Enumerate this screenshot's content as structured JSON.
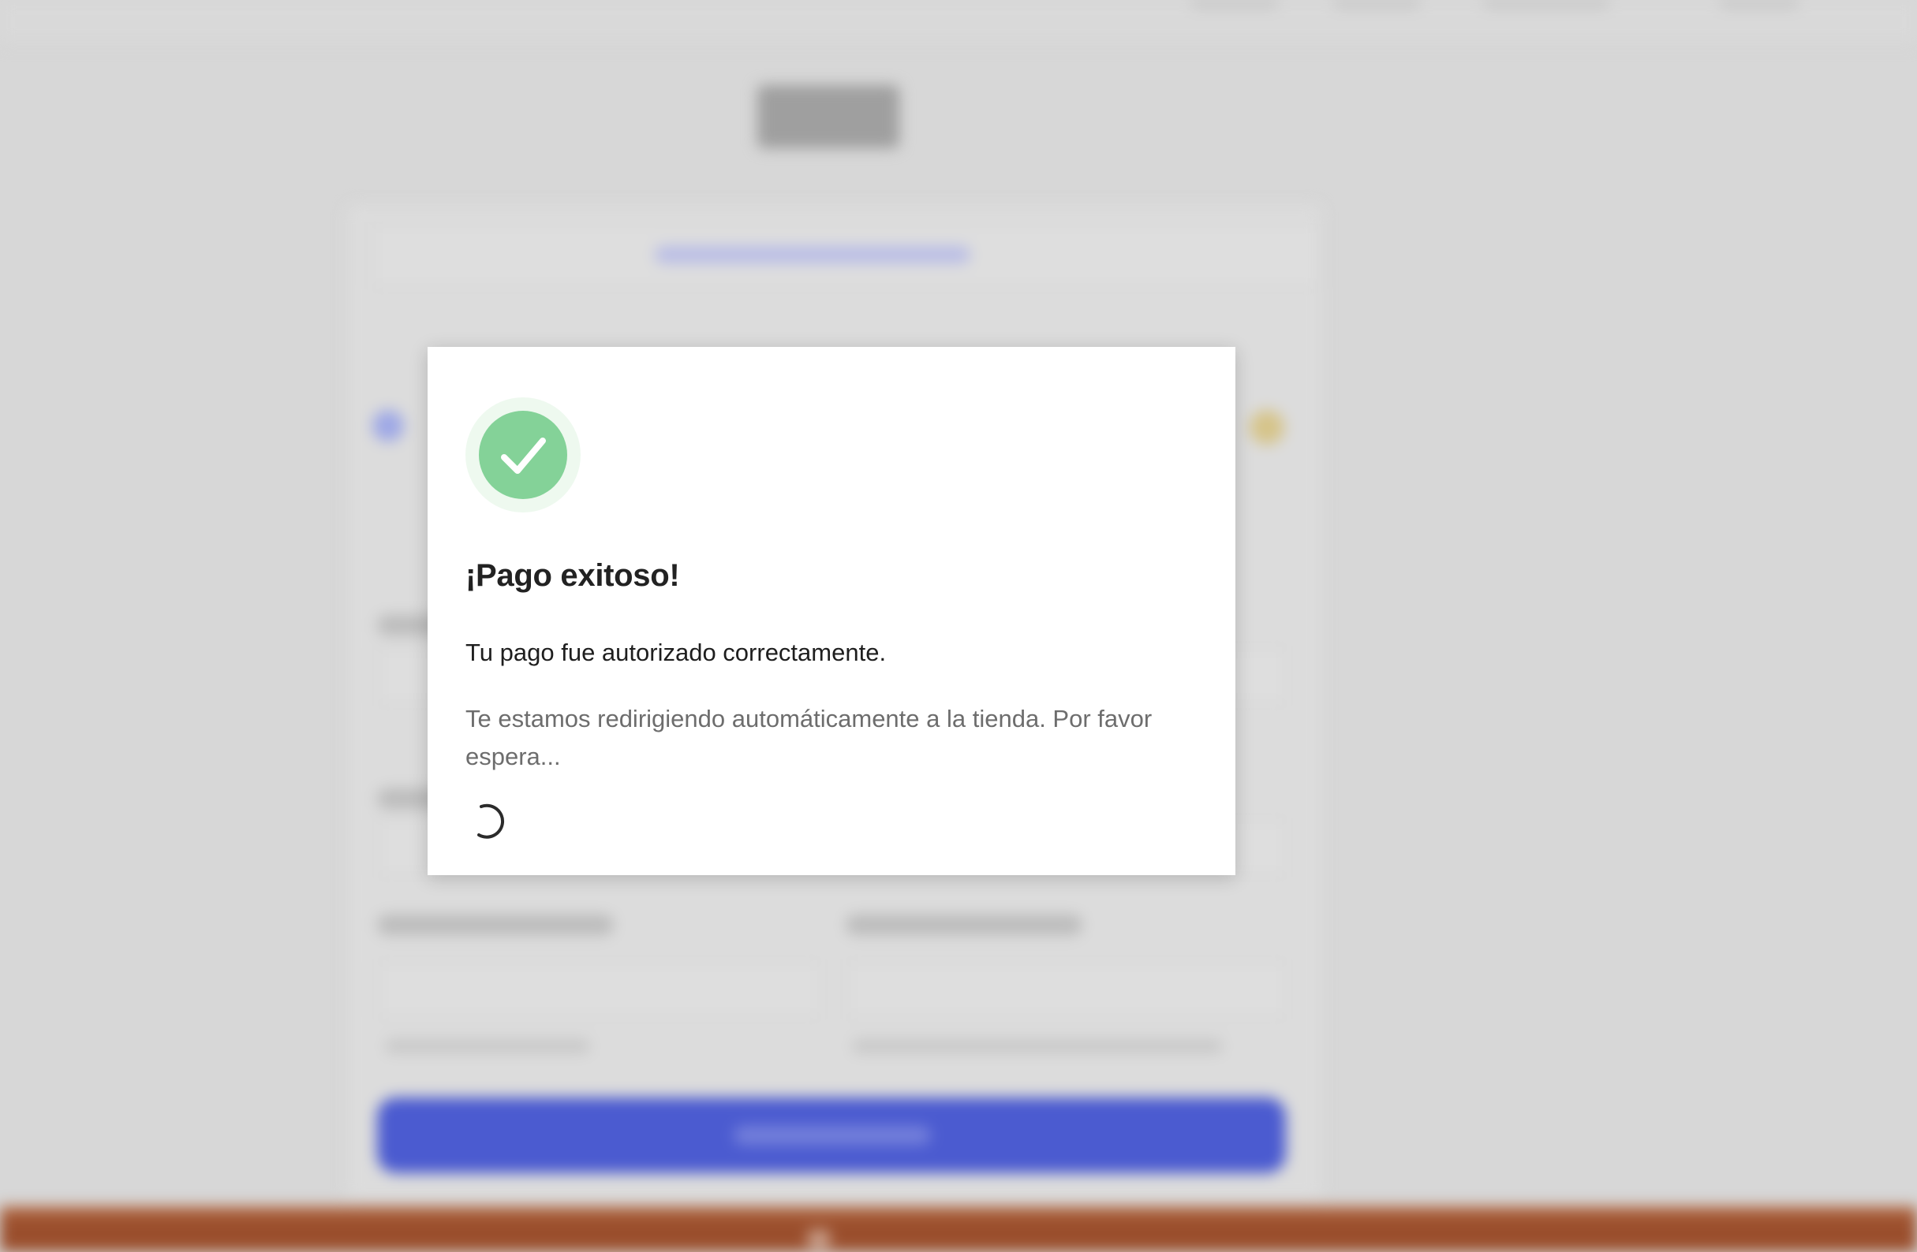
{
  "modal": {
    "title": "¡Pago exitoso!",
    "message": "Tu pago fue autorizado correctamente.",
    "note": "Te estamos redirigiendo automáticamente a la tienda. Por favor espera...",
    "icon": "check-circle-icon",
    "loading_icon": "spinner-icon"
  },
  "colors": {
    "success": "#84d298",
    "success_halo": "#eef9ef",
    "overlay": "#d7d7d7",
    "pay_button": "#4b5bd0",
    "bottom_bar": "#9a4e2c"
  }
}
